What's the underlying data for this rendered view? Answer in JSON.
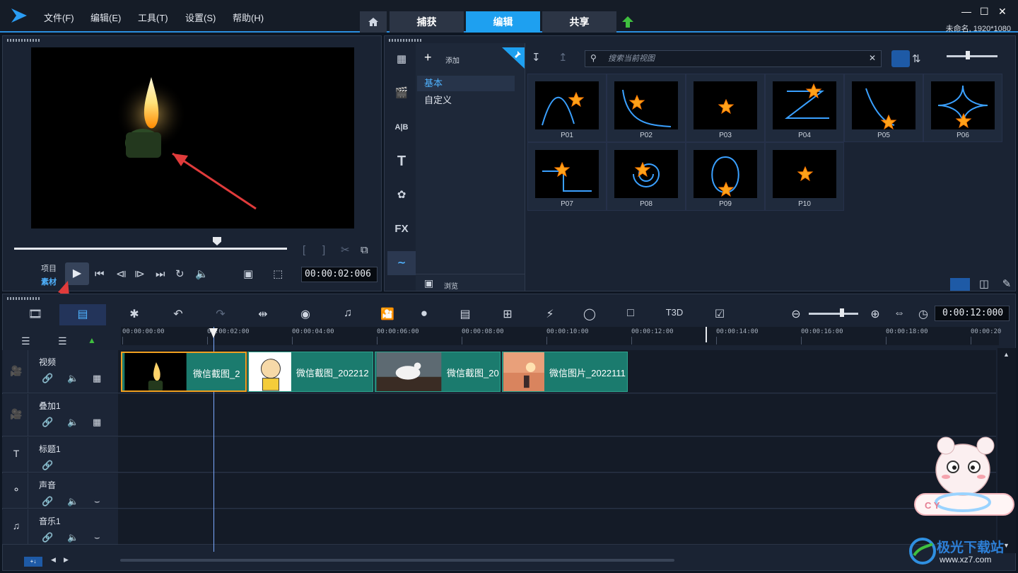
{
  "menu": {
    "items": [
      "文件(F)",
      "编辑(E)",
      "工具(T)",
      "设置(S)",
      "帮助(H)"
    ]
  },
  "tabs": [
    "捕获",
    "编辑",
    "共享"
  ],
  "window": {
    "project_info": "未命名, 1920*1080"
  },
  "preview": {
    "project_label": "项目",
    "clip_label": "素材",
    "timecode": "00:00:02:006"
  },
  "library": {
    "add_label": "添加",
    "categories": [
      "基本",
      "自定义"
    ],
    "browse_label": "浏览",
    "search_placeholder": "搜索当前视图",
    "thumbnails": [
      "P01",
      "P02",
      "P03",
      "P04",
      "P05",
      "P06",
      "P07",
      "P08",
      "P09",
      "P10"
    ]
  },
  "timeline": {
    "total_time": "0:00:12:000",
    "ruler": [
      "00:00:00:00",
      "00:00:02:00",
      "00:00:04:00",
      "00:00:06:00",
      "00:00:08:00",
      "00:00:10:00",
      "00:00:12:00",
      "00:00:14:00",
      "00:00:16:00",
      "00:00:18:00",
      "00:00:20"
    ],
    "tracks": [
      "视频",
      "叠加1",
      "标题1",
      "声音",
      "音乐1"
    ],
    "clips": [
      "微信截图_2",
      "微信截图_202212",
      "微信截图_20",
      "微信图片_2022111"
    ]
  },
  "watermark": {
    "site": "www.xz7.com",
    "brand": "极光下载站"
  },
  "colors": {
    "accent": "#1ea0f0",
    "clip": "#1b7b6e",
    "annotation_arrow": "#e03b3b"
  }
}
